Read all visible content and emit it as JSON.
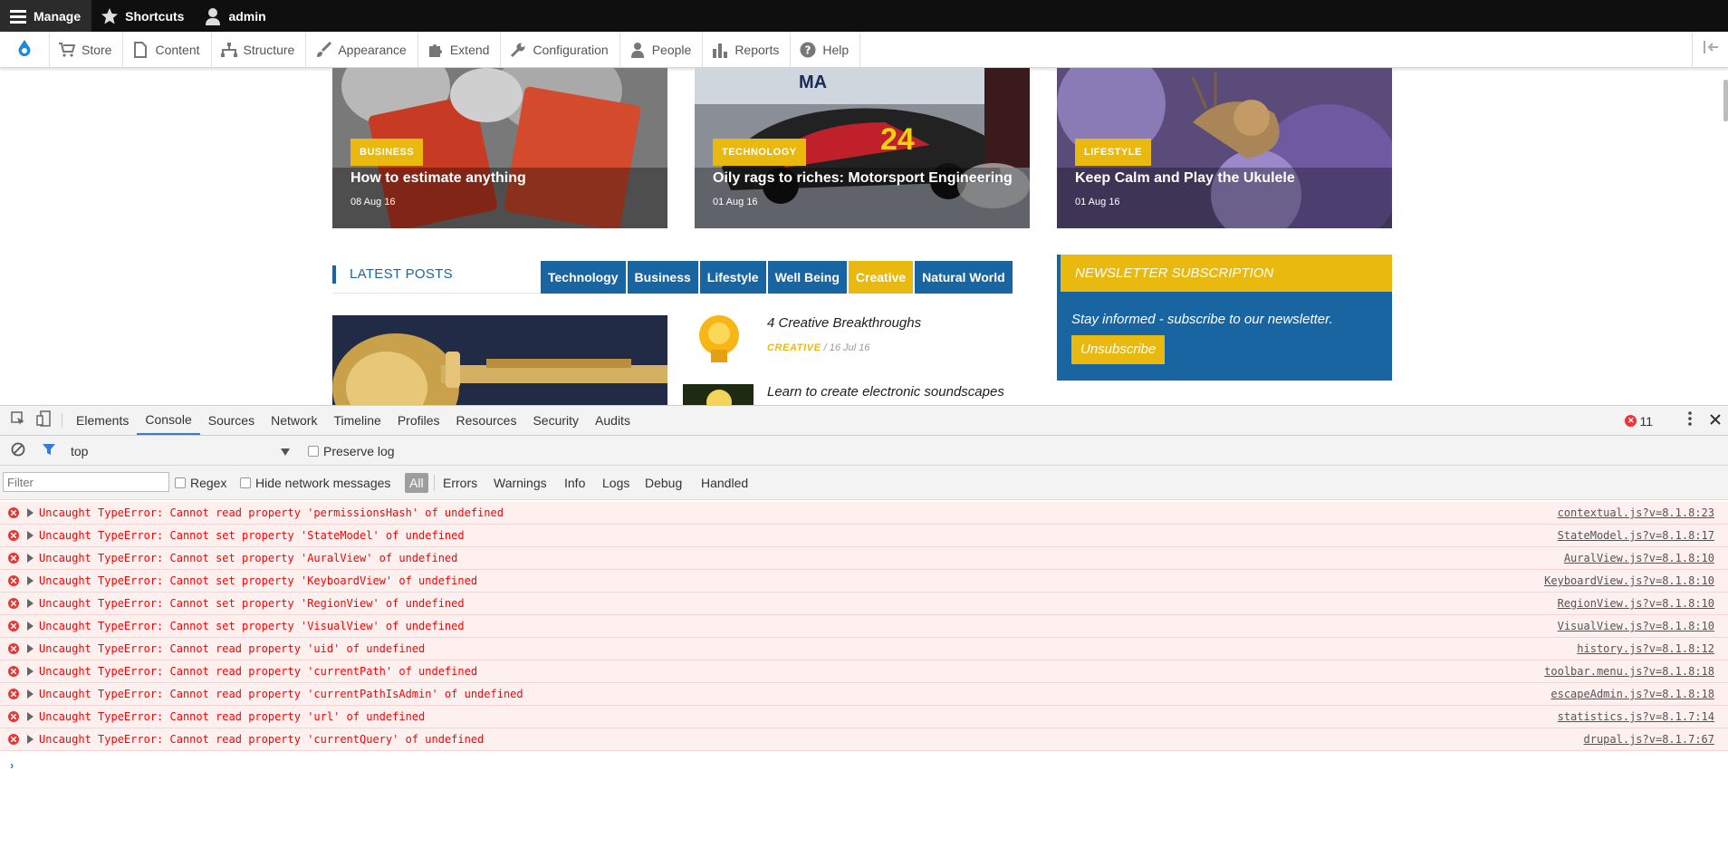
{
  "admin_toolbar": {
    "manage": "Manage",
    "shortcuts": "Shortcuts",
    "user": "admin"
  },
  "admin_tray": {
    "items": [
      {
        "label": "Store",
        "icon": "cart-icon"
      },
      {
        "label": "Content",
        "icon": "page-icon"
      },
      {
        "label": "Structure",
        "icon": "structure-icon"
      },
      {
        "label": "Appearance",
        "icon": "brush-icon"
      },
      {
        "label": "Extend",
        "icon": "puzzle-icon"
      },
      {
        "label": "Configuration",
        "icon": "wrench-icon"
      },
      {
        "label": "People",
        "icon": "people-icon"
      },
      {
        "label": "Reports",
        "icon": "chart-icon"
      },
      {
        "label": "Help",
        "icon": "help-icon"
      }
    ]
  },
  "cards": [
    {
      "badge": "BUSINESS",
      "title": "How to estimate anything",
      "date": "08 Aug 16"
    },
    {
      "badge": "TECHNOLOGY",
      "title": "Oily rags to riches: Motorsport Engineering",
      "date": "01 Aug 16"
    },
    {
      "badge": "LIFESTYLE",
      "title": "Keep Calm and Play the Ukulele",
      "date": "01 Aug 16"
    }
  ],
  "latest_posts": {
    "label": "LATEST POSTS",
    "tabs": [
      "Technology",
      "Business",
      "Lifestyle",
      "Well Being",
      "Creative",
      "Natural World"
    ],
    "active_tab": "Creative"
  },
  "posts": [
    {
      "title": "4 Creative Breakthroughs",
      "category": "CREATIVE",
      "date": "/ 16 Jul 16"
    },
    {
      "title": "Learn to create electronic soundscapes"
    }
  ],
  "newsletter": {
    "title": "NEWSLETTER SUBSCRIPTION",
    "text": "Stay informed - subscribe to our newsletter.",
    "button": "Unsubscribe"
  },
  "devtools": {
    "tabs": [
      "Elements",
      "Console",
      "Sources",
      "Network",
      "Timeline",
      "Profiles",
      "Resources",
      "Security",
      "Audits"
    ],
    "active_tab": "Console",
    "error_count": "11",
    "context": "top",
    "preserve_log": "Preserve log",
    "filter_placeholder": "Filter",
    "regex": "Regex",
    "hide_network": "Hide network messages",
    "levels": [
      "All",
      "Errors",
      "Warnings",
      "Info",
      "Logs",
      "Debug",
      "Handled"
    ],
    "messages": [
      {
        "text": "Uncaught TypeError: Cannot read property 'permissionsHash' of undefined",
        "source": "contextual.js?v=8.1.8:23"
      },
      {
        "text": "Uncaught TypeError: Cannot set property 'StateModel' of undefined",
        "source": "StateModel.js?v=8.1.8:17"
      },
      {
        "text": "Uncaught TypeError: Cannot set property 'AuralView' of undefined",
        "source": "AuralView.js?v=8.1.8:10"
      },
      {
        "text": "Uncaught TypeError: Cannot set property 'KeyboardView' of undefined",
        "source": "KeyboardView.js?v=8.1.8:10"
      },
      {
        "text": "Uncaught TypeError: Cannot set property 'RegionView' of undefined",
        "source": "RegionView.js?v=8.1.8:10"
      },
      {
        "text": "Uncaught TypeError: Cannot set property 'VisualView' of undefined",
        "source": "VisualView.js?v=8.1.8:10"
      },
      {
        "text": "Uncaught TypeError: Cannot read property 'uid' of undefined",
        "source": "history.js?v=8.1.8:12"
      },
      {
        "text": "Uncaught TypeError: Cannot read property 'currentPath' of undefined",
        "source": "toolbar.menu.js?v=8.1.8:18"
      },
      {
        "text": "Uncaught TypeError: Cannot read property 'currentPathIsAdmin' of undefined",
        "source": "escapeAdmin.js?v=8.1.8:18"
      },
      {
        "text": "Uncaught TypeError: Cannot read property 'url' of undefined",
        "source": "statistics.js?v=8.1.7:14"
      },
      {
        "text": "Uncaught TypeError: Cannot read property 'currentQuery' of undefined",
        "source": "drupal.js?v=8.1.7:67"
      }
    ],
    "prompt": "›"
  },
  "colors": {
    "accent_yellow": "#e9b90f",
    "accent_blue": "#1865a2",
    "error_red": "#ff0000"
  }
}
